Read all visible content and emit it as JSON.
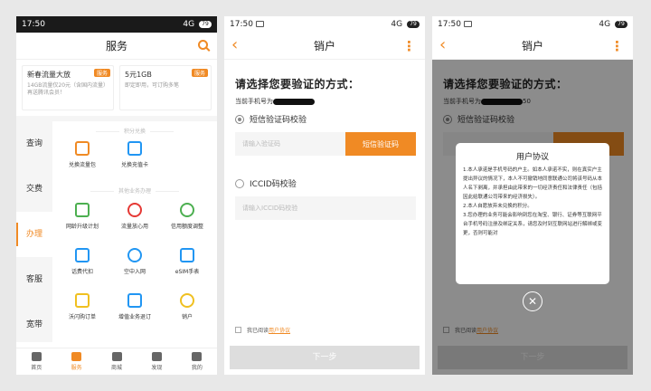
{
  "status": {
    "time": "17:50",
    "signal": "4G",
    "battery": "79"
  },
  "home": {
    "title": "服务",
    "promos": [
      {
        "title": "新春流量大放",
        "tag": "服务",
        "desc": "14GB流量仅20元（含国内流量）再送腾讯会员！"
      },
      {
        "title": "5元1GB",
        "tag": "服务",
        "desc": "即定即用，可订购多笔"
      }
    ],
    "side": [
      "查询",
      "交费",
      "办理",
      "客服",
      "宽带"
    ],
    "sections": [
      "积分兑换",
      "其他业务办理"
    ],
    "items": [
      "兑换流量包",
      "兑换充值卡",
      "网龄升级计划",
      "流量放心用",
      "信用额度调整",
      "话费代扣",
      "空中入网",
      "eSIM手表",
      "沃闪购订单",
      "增值业务退订",
      "销户"
    ],
    "tabs": [
      "首页",
      "服务",
      "商城",
      "发现",
      "我的"
    ]
  },
  "verify": {
    "title": "销户",
    "heading": "请选择您要验证的方式：",
    "phone_label": "当前手机号为",
    "phone_tail": "50",
    "opt_sms": "短信验证码校验",
    "sms_placeholder": "请输入验证码",
    "sms_btn": "短信验证码",
    "opt_iccid": "ICCID码校验",
    "iccid_placeholder": "请输入ICCID码校验",
    "agree_prefix": "我已阅读",
    "agree_link": "用户协议",
    "next": "下一步"
  },
  "modal": {
    "title": "用户协议",
    "body": "1.本人承诺是手机号码的户主。如本人承诺不实，则在真实户主提出异议的情况下，本人不可撤销地同意联通公司将该号码从本人名下剥离，并承担由此带来的一切经济责任和法律责任（包括因此给联通公司带来的经济损失）。\n2.本人自愿放弃未兑换的积分。\n3.您办理的业务可能会影响到您在淘宝、银行、证券等互联网平台手机号码注册及绑定关系，请您及时到互联网站进行解绑或变更，否则可能对"
  }
}
